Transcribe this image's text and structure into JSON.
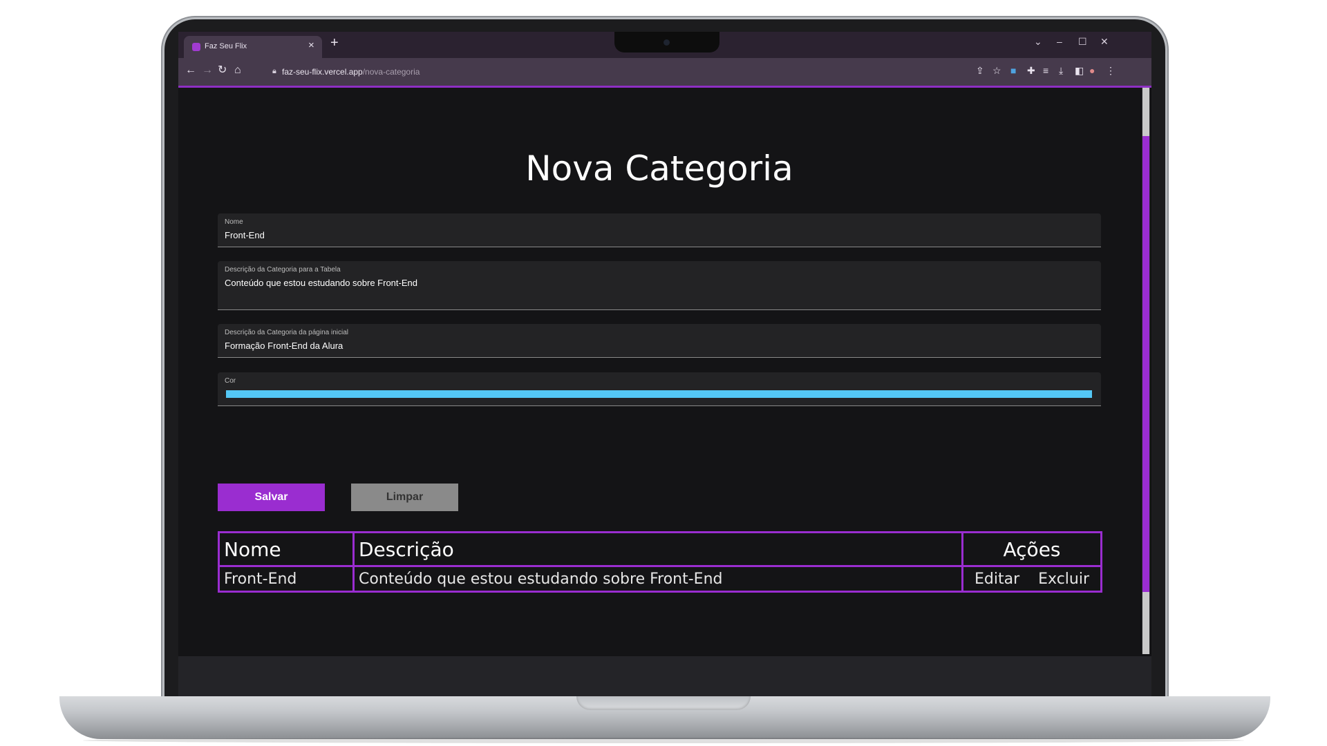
{
  "browser": {
    "tab_title": "Faz Seu Flix",
    "tab_close": "×",
    "new_tab": "+",
    "url_domain": "faz-seu-flix.vercel.app",
    "url_path": "/nova-categoria",
    "window_controls": [
      "⌄",
      "–",
      "☐",
      "✕"
    ],
    "nav_icons": [
      "arrow-left-icon",
      "arrow-right-icon",
      "reload-icon",
      "home-icon"
    ],
    "toolbar_icons": [
      "share-icon",
      "star-icon",
      "extension-app-icon",
      "puzzle-icon",
      "media-queue-icon",
      "download-icon",
      "sidepanel-icon",
      "profile-avatar-icon",
      "kebab-menu-icon"
    ]
  },
  "page": {
    "title": "Nova Categoria",
    "accent_color": "#9a2dd0",
    "form": {
      "nome_label": "Nome",
      "nome_value": "Front-End",
      "desc_tabela_label": "Descrição da Categoria para a Tabela",
      "desc_tabela_value": "Conteúdo que estou estudando sobre Front-End",
      "desc_inicial_label": "Descrição da Categoria da página inicial",
      "desc_inicial_value": "Formação Front-End da Alura",
      "cor_label": "Cor",
      "cor_value": "#54c7f5"
    },
    "buttons": {
      "save": "Salvar",
      "clear": "Limpar"
    },
    "table": {
      "headers": [
        "Nome",
        "Descrição",
        "Ações"
      ],
      "rows": [
        {
          "nome": "Front-End",
          "descricao": "Conteúdo que estou estudando sobre Front-End",
          "editar": "Editar",
          "excluir": "Excluir"
        }
      ]
    }
  }
}
